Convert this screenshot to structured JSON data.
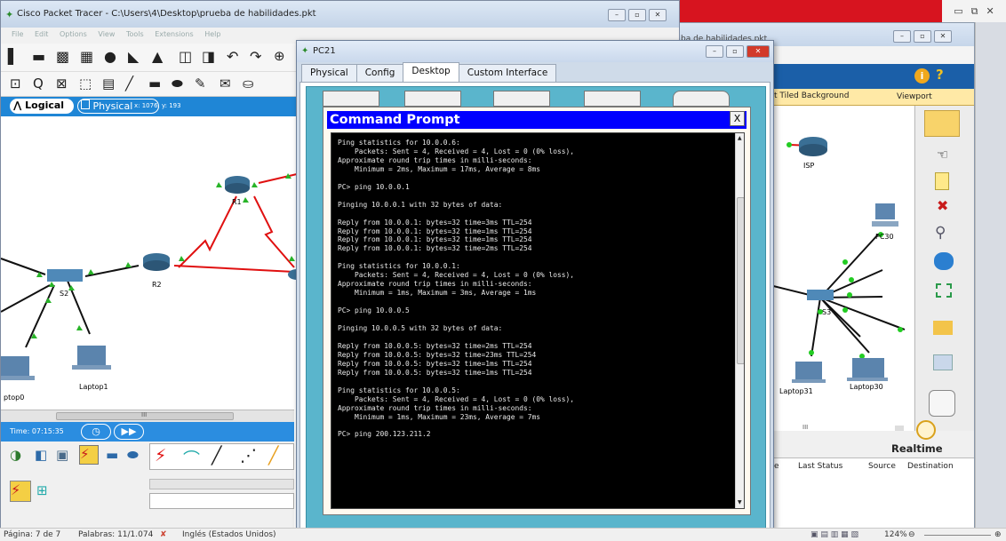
{
  "pt_window": {
    "title": "Cisco Packet Tracer - C:\\Users\\4\\Desktop\\prueba de habilidades.pkt",
    "menu": [
      "File",
      "Edit",
      "Options",
      "View",
      "Tools",
      "Extensions",
      "Help"
    ],
    "nav": {
      "logical": "Logical",
      "physical": "Physical",
      "coords": "x: 1076, y: 193"
    },
    "time": "Time: 07:15:35",
    "nodes": [
      "R1",
      "R2",
      "S2",
      "Laptop1",
      "ptop0"
    ],
    "scroll_marker": "III"
  },
  "pt_window2": {
    "title": "ba de habilidades.pkt",
    "strip_left": "t Tiled Background",
    "strip_right": "Viewport",
    "nodes": [
      "ISP",
      "PC30",
      "S3",
      "Laptop31",
      "Laptop30"
    ],
    "realtime": "Realtime",
    "table_headers": [
      "e",
      "Last Status",
      "Source",
      "Destination"
    ],
    "scroll_marker": "III"
  },
  "pc_window": {
    "title": "PC21",
    "tabs": [
      "Physical",
      "Config",
      "Desktop",
      "Custom Interface"
    ],
    "active_tab": "Desktop",
    "cmd_title": "Command Prompt",
    "cmd_close": "X",
    "terminal_lines": [
      "Ping statistics for 10.0.0.6:",
      "    Packets: Sent = 4, Received = 4, Lost = 0 (0% loss),",
      "Approximate round trip times in milli-seconds:",
      "    Minimum = 2ms, Maximum = 17ms, Average = 8ms",
      "",
      "PC> ping 10.0.0.1",
      "",
      "Pinging 10.0.0.1 with 32 bytes of data:",
      "",
      "Reply from 10.0.0.1: bytes=32 time=3ms TTL=254",
      "Reply from 10.0.0.1: bytes=32 time=1ms TTL=254",
      "Reply from 10.0.0.1: bytes=32 time=1ms TTL=254",
      "Reply from 10.0.0.1: bytes=32 time=2ms TTL=254",
      "",
      "Ping statistics for 10.0.0.1:",
      "    Packets: Sent = 4, Received = 4, Lost = 0 (0% loss),",
      "Approximate round trip times in milli-seconds:",
      "    Minimum = 1ms, Maximum = 3ms, Average = 1ms",
      "",
      "PC> ping 10.0.0.5",
      "",
      "Pinging 10.0.0.5 with 32 bytes of data:",
      "",
      "Reply from 10.0.0.5: bytes=32 time=2ms TTL=254",
      "Reply from 10.0.0.5: bytes=32 time=23ms TTL=254",
      "Reply from 10.0.0.5: bytes=32 time=1ms TTL=254",
      "Reply from 10.0.0.5: bytes=32 time=1ms TTL=254",
      "",
      "Ping statistics for 10.0.0.5:",
      "    Packets: Sent = 4, Received = 4, Lost = 0 (0% loss),",
      "Approximate round trip times in milli-seconds:",
      "    Minimum = 1ms, Maximum = 23ms, Average = 7ms",
      "",
      "PC> ping 200.123.211.2"
    ]
  },
  "word": {
    "status_page": "Página: 7 de 7",
    "status_words": "Palabras: 11/1.074",
    "status_lang": "Inglés (Estados Unidos)",
    "zoom": "124%"
  },
  "colors": {
    "cmd_title_bg": "#0000ff",
    "teal": "#5ab5cc",
    "link_red": "#e01010",
    "pt_blue": "#1f86d6"
  }
}
